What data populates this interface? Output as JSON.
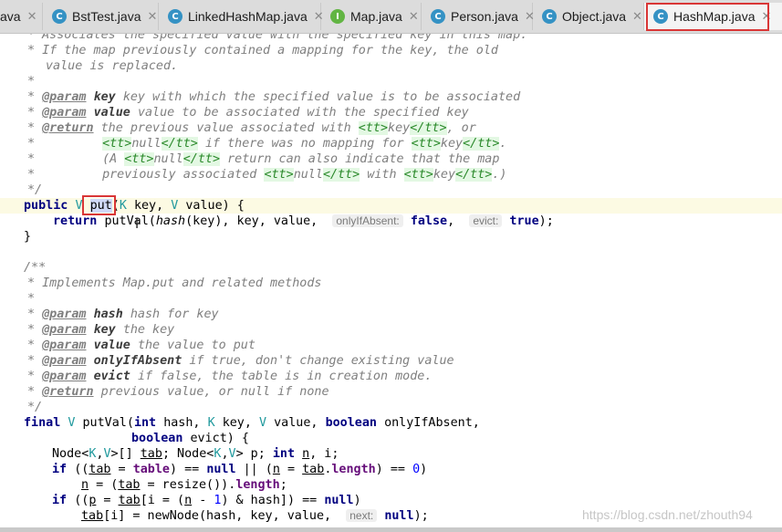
{
  "tabs": [
    {
      "label": "ava",
      "icon": "",
      "icon_color": ""
    },
    {
      "label": "BstTest.java",
      "icon": "C",
      "icon_color": "#3592c4"
    },
    {
      "label": "LinkedHashMap.java",
      "icon": "C",
      "icon_color": "#3592c4"
    },
    {
      "label": "Map.java",
      "icon": "I",
      "icon_color": "#62b543"
    },
    {
      "label": "Person.java",
      "icon": "C",
      "icon_color": "#3592c4"
    },
    {
      "label": "Object.java",
      "icon": "C",
      "icon_color": "#3592c4"
    },
    {
      "label": "HashMap.java",
      "icon": "C",
      "icon_color": "#3592c4"
    }
  ],
  "close_glyph": "✕",
  "colors": {
    "highlight_box": "#d93636",
    "comment": "#7f7f7f",
    "keyword": "#000080",
    "html_tag": "#2c8a2c"
  },
  "code": {
    "l1": [
      "* Associates the specified value with the specified key in this map."
    ],
    "l2": [
      "* If the map previously contained a mapping for the key, the old"
    ],
    "l3": [
      "value is replaced."
    ],
    "l4": [
      "*"
    ],
    "l5": [
      "*",
      "@param",
      "key",
      "key with which the specified value is to be associated"
    ],
    "l6": [
      "*",
      "@param",
      "value",
      "value to be associated with the specified key"
    ],
    "l7": [
      "*",
      "@return",
      "the previous value associated with",
      "<tt>",
      "key",
      "</tt>",
      ", or"
    ],
    "l8": [
      "*",
      "<tt>",
      "null",
      "</tt>",
      "if there was no mapping for",
      "<tt>",
      "key",
      "</tt>",
      "."
    ],
    "l9": [
      "*",
      "(A",
      "<tt>",
      "null",
      "</tt>",
      "return can also indicate that the map"
    ],
    "l10": [
      "*",
      "previously associated",
      "<tt>",
      "null",
      "</tt>",
      "with",
      "<tt>",
      "key",
      "</tt>",
      ".)"
    ],
    "l11": [
      "*/"
    ],
    "l12": [
      "public",
      "V",
      "put",
      "(",
      "K",
      "key,",
      "V",
      "value) {"
    ],
    "l13": [
      "return",
      "putVal(",
      "hash",
      "(key), key, value,",
      "onlyIfAbsent:",
      "false",
      ",",
      "evict:",
      "true",
      ");"
    ],
    "l14": [
      "}"
    ],
    "l16": [
      "/**"
    ],
    "l17": [
      "* Implements Map.put and related methods"
    ],
    "l18": [
      "*"
    ],
    "l19": [
      "*",
      "@param",
      "hash",
      "hash for key"
    ],
    "l20": [
      "*",
      "@param",
      "key",
      "the key"
    ],
    "l21": [
      "*",
      "@param",
      "value",
      "the value to put"
    ],
    "l22": [
      "*",
      "@param",
      "onlyIfAbsent",
      "if true, don't change existing value"
    ],
    "l23": [
      "*",
      "@param",
      "evict",
      "if false, the table is in creation mode."
    ],
    "l24": [
      "*",
      "@return",
      "previous value, or null if none"
    ],
    "l25": [
      "*/"
    ],
    "l26": [
      "final",
      "V",
      "putVal(",
      "int",
      "hash,",
      "K",
      "key,",
      "V",
      "value,",
      "boolean",
      "onlyIfAbsent,"
    ],
    "l27": [
      "boolean",
      "evict) {"
    ],
    "l28": [
      "Node<",
      "K",
      ",",
      "V",
      ">[]",
      "tab",
      "; Node<",
      "K",
      ",",
      "V",
      "> p;",
      "int",
      "n",
      ", i;"
    ],
    "l29": [
      "if",
      "((",
      "tab",
      " = ",
      "table",
      ") == ",
      "null",
      " || (",
      "n",
      " = ",
      "tab",
      ".",
      "length",
      ") == ",
      "0",
      ")"
    ],
    "l30": [
      "n",
      " = (",
      "tab",
      " = resize()).",
      "length",
      ";"
    ],
    "l31": [
      "if",
      "((",
      "p",
      " = ",
      "tab",
      "[i = (",
      "n",
      " - ",
      "1",
      ") & hash]) == ",
      "null",
      ")"
    ],
    "l32": [
      "tab",
      "[i] = newNode(hash, key, value,",
      "next:",
      "null",
      ");"
    ]
  },
  "watermark": "https://blog.csdn.net/zhouth94"
}
